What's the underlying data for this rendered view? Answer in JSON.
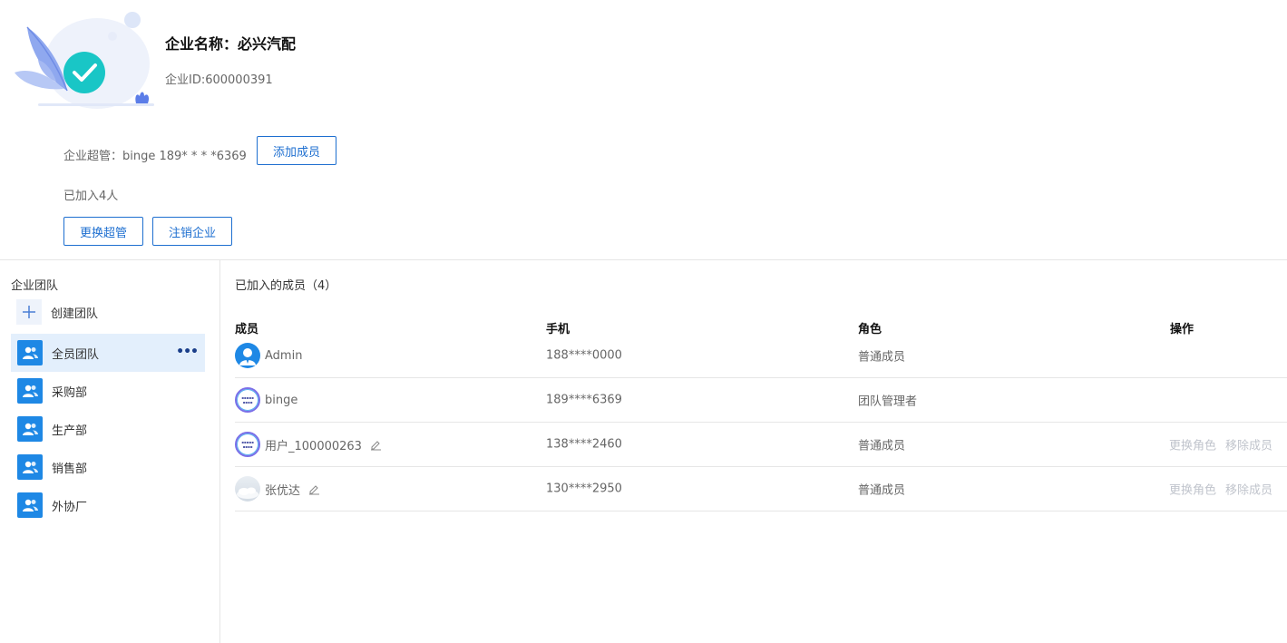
{
  "company": {
    "name": "企业名称：必兴汽配",
    "id": "企业ID:600000391"
  },
  "admin": {
    "text": "企业超管：binge 189* * * *6369",
    "add_button": "添加成员"
  },
  "joined_count": "已加入4人",
  "actions": {
    "switch_admin": "更换超管",
    "cancel_company": "注销企业"
  },
  "sidebar": {
    "title": "企业团队",
    "create_team": "创建团队",
    "teams": [
      {
        "label": "全员团队",
        "active": true
      },
      {
        "label": "采购部"
      },
      {
        "label": "生产部"
      },
      {
        "label": "销售部"
      },
      {
        "label": "外协厂"
      }
    ]
  },
  "members": {
    "title": "已加入的成员（4）",
    "columns": [
      "成员",
      "手机",
      "角色",
      "操作"
    ],
    "rows": [
      {
        "name": "Admin",
        "phone": "188****0000",
        "role": "普通成员",
        "avatar": "admin-avatar",
        "editable": false,
        "ops": []
      },
      {
        "name": "binge",
        "phone": "189****6369",
        "role": "团队管理者",
        "avatar": "logo-avatar",
        "editable": false,
        "ops": []
      },
      {
        "name": "用户_100000263",
        "phone": "138****2460",
        "role": "普通成员",
        "avatar": "logo-avatar",
        "editable": true,
        "ops": [
          "更换角色",
          "移除成员"
        ]
      },
      {
        "name": "张优达",
        "phone": "130****2950",
        "role": "普通成员",
        "avatar": "cloud-avatar",
        "editable": true,
        "ops": [
          "更换角色",
          "移除成员"
        ]
      }
    ]
  },
  "colors": {
    "accent": "#1e6fd0",
    "team_icon": "#1e88e5",
    "active_bg": "#e3effc",
    "check_circle": "#19c6c6"
  }
}
